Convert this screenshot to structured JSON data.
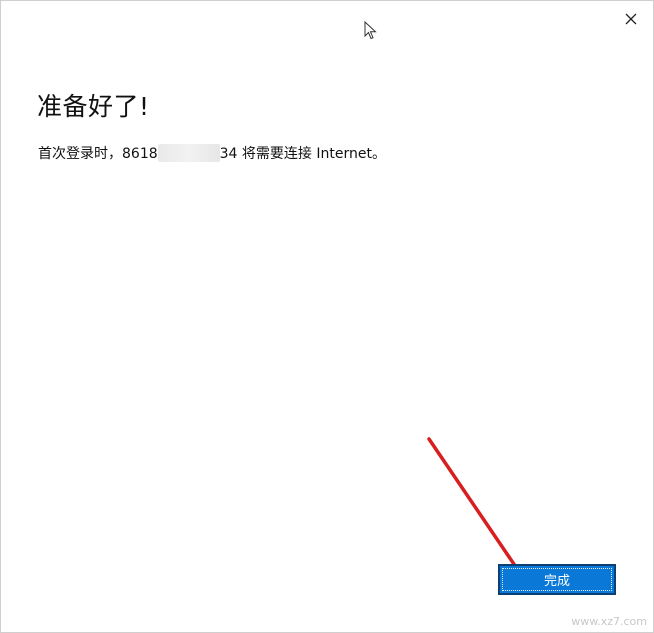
{
  "dialog": {
    "title": "准备好了!",
    "message_prefix": "首次登录时，8618",
    "message_suffix": "34 将需要连接 Internet。",
    "done_label": "完成",
    "close_label": "✕"
  },
  "watermark": {
    "text": "www.xz7.com"
  },
  "colors": {
    "accent": "#0a78d7",
    "annotation_arrow": "#d81e1e"
  },
  "icons": [
    "close-icon",
    "mouse-pointer-icon",
    "annotation-arrow-icon"
  ]
}
